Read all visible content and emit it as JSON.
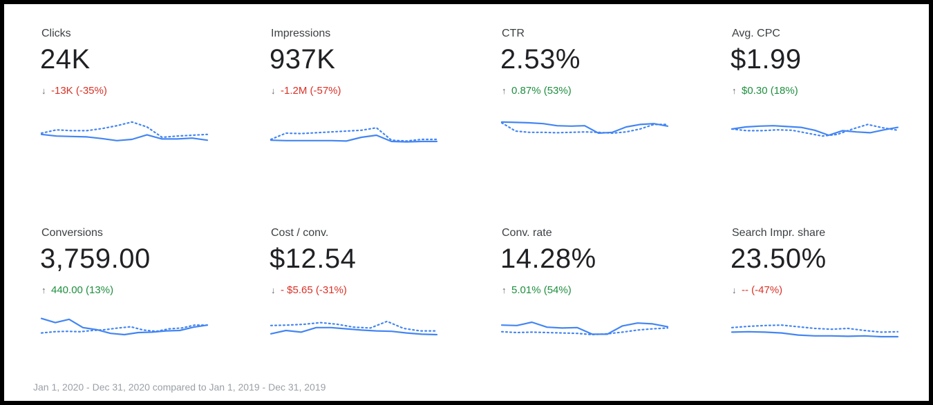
{
  "metrics": [
    {
      "label": "Clicks",
      "value": "24K",
      "change": "-13K (-35%)",
      "direction": "down",
      "current": [
        42,
        38,
        37,
        36,
        32,
        27,
        30,
        41,
        31,
        31,
        33,
        28
      ],
      "previous": [
        45,
        53,
        51,
        51,
        56,
        63,
        72,
        60,
        35,
        38,
        40,
        42
      ]
    },
    {
      "label": "Impressions",
      "value": "937K",
      "change": "-1.2M (-57%)",
      "direction": "down",
      "current": [
        28,
        27,
        27,
        27,
        27,
        26,
        35,
        40,
        25,
        24,
        25,
        25
      ],
      "previous": [
        30,
        45,
        44,
        46,
        48,
        50,
        52,
        58,
        28,
        26,
        30,
        30
      ]
    },
    {
      "label": "CTR",
      "value": "2.53%",
      "change": "0.87% (53%)",
      "direction": "up",
      "current": [
        72,
        71,
        70,
        68,
        63,
        62,
        63,
        45,
        47,
        60,
        66,
        68,
        62
      ],
      "previous": [
        70,
        50,
        47,
        47,
        46,
        47,
        48,
        47,
        45,
        48,
        55,
        66,
        66
      ]
    },
    {
      "label": "Avg. CPC",
      "value": "$1.99",
      "change": "$0.30 (18%)",
      "direction": "up",
      "current": [
        55,
        60,
        62,
        63,
        61,
        59,
        52,
        40,
        51,
        48,
        46,
        53,
        59
      ],
      "previous": [
        55,
        51,
        51,
        53,
        52,
        45,
        38,
        42,
        55,
        66,
        58,
        52
      ]
    },
    {
      "label": "Conversions",
      "value": "3,759.00",
      "change": "440.00 (13%)",
      "direction": "up",
      "current": [
        79,
        69,
        77,
        57,
        52,
        43,
        40,
        45,
        46,
        49,
        50,
        58,
        63
      ],
      "previous": [
        44,
        47,
        48,
        47,
        50,
        52,
        56,
        59,
        51,
        48,
        54,
        56,
        63,
        63
      ]
    },
    {
      "label": "Cost / conv.",
      "value": "$12.54",
      "change": "- $5.65 (-31%)",
      "direction": "down",
      "current": [
        42,
        50,
        46,
        57,
        57,
        54,
        51,
        49,
        48,
        44,
        41,
        40
      ],
      "previous": [
        62,
        63,
        65,
        69,
        65,
        58,
        56,
        72,
        55,
        49,
        49
      ]
    },
    {
      "label": "Conv. rate",
      "value": "14.28%",
      "change": "5.01% (54%)",
      "direction": "up",
      "current": [
        63,
        62,
        70,
        58,
        56,
        57,
        41,
        41,
        61,
        68,
        66,
        59
      ],
      "previous": [
        47,
        45,
        46,
        45,
        44,
        43,
        40,
        42,
        46,
        51,
        54,
        56
      ]
    },
    {
      "label": "Search Impr. share",
      "value": "23.50%",
      "change": "-- (-47%)",
      "direction": "down",
      "current": [
        46,
        47,
        46,
        44,
        39,
        37,
        37,
        36,
        37,
        35,
        35
      ],
      "previous": [
        57,
        60,
        62,
        63,
        59,
        55,
        53,
        55,
        50,
        46,
        47
      ]
    }
  ],
  "footer": "Jan 1, 2020 - Dec 31, 2020 compared to Jan 1, 2019 - Dec 31, 2019",
  "colors": {
    "line": "#4285f4",
    "up": "#1e8e3e",
    "down": "#d93025",
    "border": "#000000"
  }
}
